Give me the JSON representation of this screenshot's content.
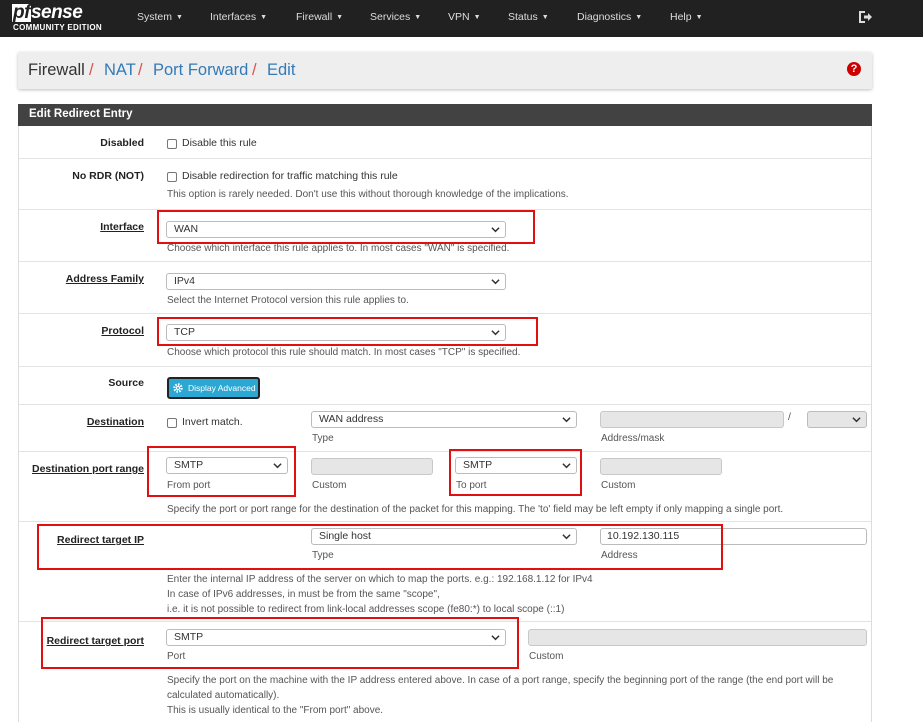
{
  "navbar": {
    "logo_brand_a": "pf",
    "logo_brand_b": "sense",
    "logo_sub": "COMMUNITY EDITION",
    "items": [
      "System",
      "Interfaces",
      "Firewall",
      "Services",
      "VPN",
      "Status",
      "Diagnostics",
      "Help"
    ],
    "logout_icon": "sign-out-icon"
  },
  "breadcrumb": {
    "firewall": "Firewall",
    "nat": "NAT",
    "port_forward": "Port Forward",
    "edit": "Edit",
    "sep": "/",
    "help_icon": "question-circle-icon"
  },
  "panel": {
    "title": "Edit Redirect Entry"
  },
  "form": {
    "disabled": {
      "label": "Disabled",
      "checkbox_label": "Disable this rule"
    },
    "nordr": {
      "label": "No RDR (NOT)",
      "checkbox_label": "Disable redirection for traffic matching this rule",
      "help": "This option is rarely needed. Don't use this without thorough knowledge of the implications."
    },
    "interface": {
      "label": "Interface",
      "value": "WAN",
      "help": "Choose which interface this rule applies to. In most cases \"WAN\" is specified."
    },
    "address_family": {
      "label": "Address Family",
      "value": "IPv4",
      "help": "Select the Internet Protocol version this rule applies to."
    },
    "protocol": {
      "label": "Protocol",
      "value": "TCP",
      "help": "Choose which protocol this rule should match. In most cases \"TCP\" is specified."
    },
    "source": {
      "label": "Source",
      "button": "Display Advanced"
    },
    "destination": {
      "label": "Destination",
      "invert": "Invert match.",
      "type_value": "WAN address",
      "type_label": "Type",
      "mask_sep": "/",
      "address_label": "Address/mask"
    },
    "dest_port": {
      "label": "Destination port range",
      "from_value": "SMTP",
      "from_label": "From port",
      "custom1_label": "Custom",
      "to_value": "SMTP",
      "to_label": "To port",
      "custom2_label": "Custom",
      "help": "Specify the port or port range for the destination of the packet for this mapping. The 'to' field may be left empty if only mapping a single port."
    },
    "redirect_ip": {
      "label": "Redirect target IP",
      "type_value": "Single host",
      "type_label": "Type",
      "address_value": "10.192.130.115",
      "address_label": "Address",
      "help1": "Enter the internal IP address of the server on which to map the ports. e.g.: 192.168.1.12 for IPv4",
      "help2": "In case of IPv6 addresses, in must be from the same \"scope\",",
      "help3": "i.e. it is not possible to redirect from link-local addresses scope (fe80:*) to local scope (::1)"
    },
    "redirect_port": {
      "label": "Redirect target port",
      "value": "SMTP",
      "port_label": "Port",
      "custom_label": "Custom",
      "help1": "Specify the port on the machine with the IP address entered above. In case of a port range, specify the beginning port of the range (the end port will be",
      "help2": "calculated automatically).",
      "help3": "This is usually identical to the \"From port\" above."
    }
  },
  "colors": {
    "navbar": "#212121",
    "panel_heading": "#424242",
    "link": "#337ab7",
    "breadcrumb_separator": "#d9534f",
    "annotation": "#e01010",
    "button": "#2aa8d3"
  }
}
